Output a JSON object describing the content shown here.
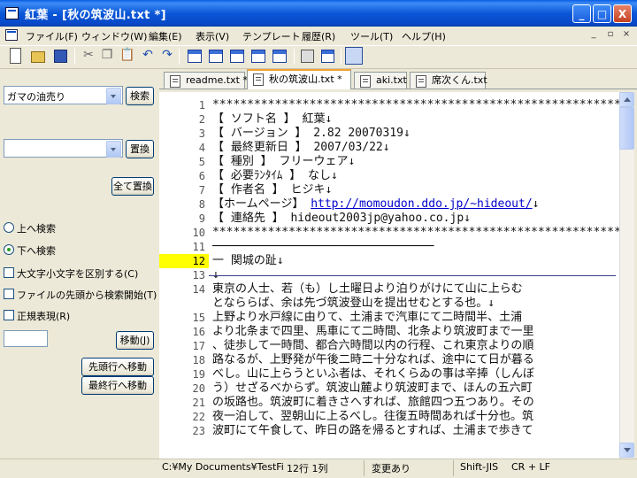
{
  "window": {
    "title": "紅葉 - [秋の筑波山.txt *]",
    "caption_minimize": "_",
    "caption_maximize": "□",
    "caption_close": "X"
  },
  "menu": {
    "items": [
      "ファイル(F)",
      "ウィンドウ(W)",
      "編集(E)",
      "表示(V)",
      "テンプレート",
      "履歴(R)",
      "ツール(T)",
      "ヘルプ(H)"
    ],
    "mdi_min": "_",
    "mdi_restore": "▫",
    "mdi_close": "×"
  },
  "toolbar": {
    "icons": [
      "new-file-icon",
      "open-folder-icon",
      "save-disk-icon",
      "cut-icon",
      "copy-icon",
      "paste-icon",
      "undo-icon",
      "redo-icon",
      "cascade-window-icon",
      "tile-window-icon",
      "tile-vertical-icon",
      "tile-horizontal-icon",
      "new-window-icon",
      "print-icon",
      "print-preview-icon",
      "side-panel-icon"
    ]
  },
  "tabs": [
    {
      "label": "readme.txt *"
    },
    {
      "label": "秋の筑波山.txt *",
      "active": true
    },
    {
      "label": "aki.txt"
    },
    {
      "label": "席次くん.txt"
    }
  ],
  "search_panel": {
    "search_value": "ガマの油売り",
    "search_button": "検索",
    "replace_value": "",
    "replace_button": "置換",
    "replace_all_button": "全て置換",
    "radio_up": "上へ検索",
    "radio_down": "下へ検索",
    "selected_direction": "down",
    "check_case": "大文字小文字を区別する(C)",
    "check_from_top": "ファイルの先頭から検索開始(T)",
    "check_regex": "正規表現(R)",
    "jump_value": "",
    "jump_button": "移動(J)",
    "goto_first_button": "先頭行へ移動",
    "goto_last_button": "最終行へ移動"
  },
  "editor": {
    "current_line": 12,
    "lines": [
      {
        "n": "1",
        "text": "****************************************************************"
      },
      {
        "n": "2",
        "text": "【  ソフト名  】   紅葉↓"
      },
      {
        "n": "3",
        "text": "【 バージョン 】   2.82 20070319↓"
      },
      {
        "n": "4",
        "text": "【 最終更新日 】   2007/03/22↓"
      },
      {
        "n": "5",
        "text": "【    種別    】   フリーウェア↓"
      },
      {
        "n": "6",
        "text": "【 必要ﾗﾝﾀｲﾑ  】   なし↓"
      },
      {
        "n": "7",
        "text": "【   作者名   】   ヒジキ↓"
      },
      {
        "n": "8",
        "text": "【ホームページ】   ",
        "link": "http://momoudon.ddo.jp/~hideout/",
        "tail": "↓"
      },
      {
        "n": "9",
        "text": "【   連絡先   】   hideout2003jp@yahoo.co.jp↓"
      },
      {
        "n": "10",
        "text": "****************************************************************"
      },
      {
        "n": "11",
        "text": "────────────────────────────────"
      },
      {
        "n": "12",
        "text": "一  関城の趾↓"
      },
      {
        "n": "13",
        "text": "↓"
      },
      {
        "n": "14",
        "text": "  東京の人士、若（も）し土曜日より泊りがけにて山に上らむ"
      },
      {
        "n": "",
        "text": "となららば、余は先づ筑波登山を提出せむとする也。↓"
      },
      {
        "n": "15",
        "text": "  上野より水戸線に由りて、土浦まで汽車にて二時間半、土浦"
      },
      {
        "n": "16",
        "text": "より北条まで四里、馬車にて二時間、北条より筑波町まで一里"
      },
      {
        "n": "17",
        "text": "、徒歩して一時間、都合六時間以内の行程、これ東京よりの順"
      },
      {
        "n": "18",
        "text": "路なるが、上野発が午後二時二十分なれば、途中にて日が暮る"
      },
      {
        "n": "19",
        "text": "べし。山に上らうといふ者は、それくらゐの事は辛捧（しんぼ"
      },
      {
        "n": "20",
        "text": "う）せざるべからず。筑波山麓より筑波町まで、ほんの五六町"
      },
      {
        "n": "21",
        "text": "の坂路也。筑波町に着きさへすれば、旅館四つ五つあり。その"
      },
      {
        "n": "22",
        "text": "夜一泊して、翌朝山に上るべし。往復五時間あれば十分也。筑"
      },
      {
        "n": "23",
        "text": "波町にて午食して、昨日の路を帰るとすれば、土浦まで歩きて"
      }
    ]
  },
  "status": {
    "path": "C:¥My Documents¥TestFi",
    "position": "12行  1列",
    "modified": "変更あり",
    "encoding": "Shift-JIS",
    "newline": "CR + LF"
  }
}
